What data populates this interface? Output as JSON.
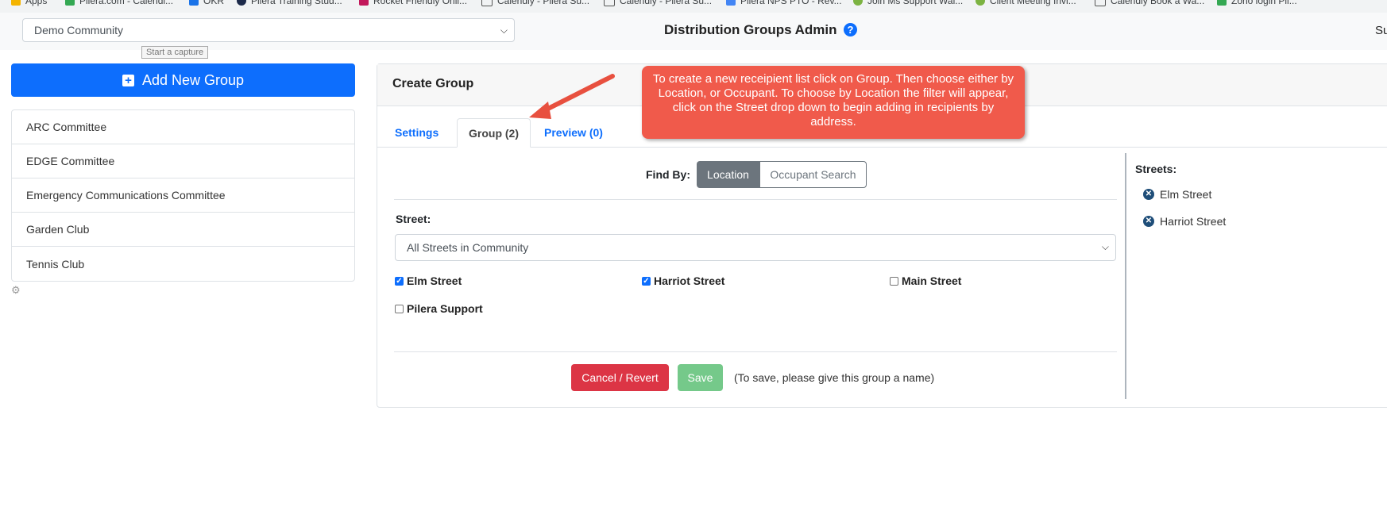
{
  "bookmarks": [
    "Apps",
    "Pilera.com - Calendl...",
    "OKR",
    "Pilera Training Stud...",
    "Rocket Friendly Onli...",
    "Calendly - Pilera Su...",
    "Calendly - Pilera Su...",
    "Pilera NPS PTO - Rev...",
    "Join Ms Support Wal...",
    "Client Meeting Invi...",
    "Calendly Book a Wa...",
    "Zoho login Pil..."
  ],
  "header": {
    "community_select": "Demo Community",
    "tooltip": "Start a capture",
    "title": "Distribution Groups Admin",
    "help_icon": "?",
    "right_text": "Su"
  },
  "sidebar": {
    "add_button": "Add New Group",
    "groups": [
      "ARC Committee",
      "EDGE Committee",
      "Emergency Communications Committee",
      "Garden Club",
      "Tennis Club"
    ]
  },
  "card": {
    "title": "Create Group",
    "tabs": [
      {
        "label": "Settings",
        "active": false
      },
      {
        "label": "Group (2)",
        "active": true
      },
      {
        "label": "Preview (0)",
        "active": false
      }
    ],
    "find_by_label": "Find By:",
    "find_by_options": [
      "Location",
      "Occupant Search"
    ],
    "street_label": "Street:",
    "street_select": "All Streets in Community",
    "street_checkboxes": [
      {
        "label": "Elm Street",
        "checked": true
      },
      {
        "label": "Harriot Street",
        "checked": true
      },
      {
        "label": "Main Street",
        "checked": false
      },
      {
        "label": "Pilera Support",
        "checked": false
      }
    ],
    "cancel_button": "Cancel / Revert",
    "save_button": "Save",
    "save_hint": "(To save, please give this group a name)",
    "streets_heading": "Streets:",
    "selected_streets": [
      "Elm Street",
      "Harriot Street"
    ]
  },
  "callout": {
    "text": "To create a new receipient list click on Group.  Then choose either by Location, or Occupant.   To choose by Location the filter will appear, click on the Street drop down to begin adding in recipients by address."
  },
  "colors": {
    "primary": "#0d6efd",
    "danger": "#dc3545",
    "success_disabled": "#75c98a",
    "secondary": "#6c757d",
    "callout": "#f05a4b"
  }
}
